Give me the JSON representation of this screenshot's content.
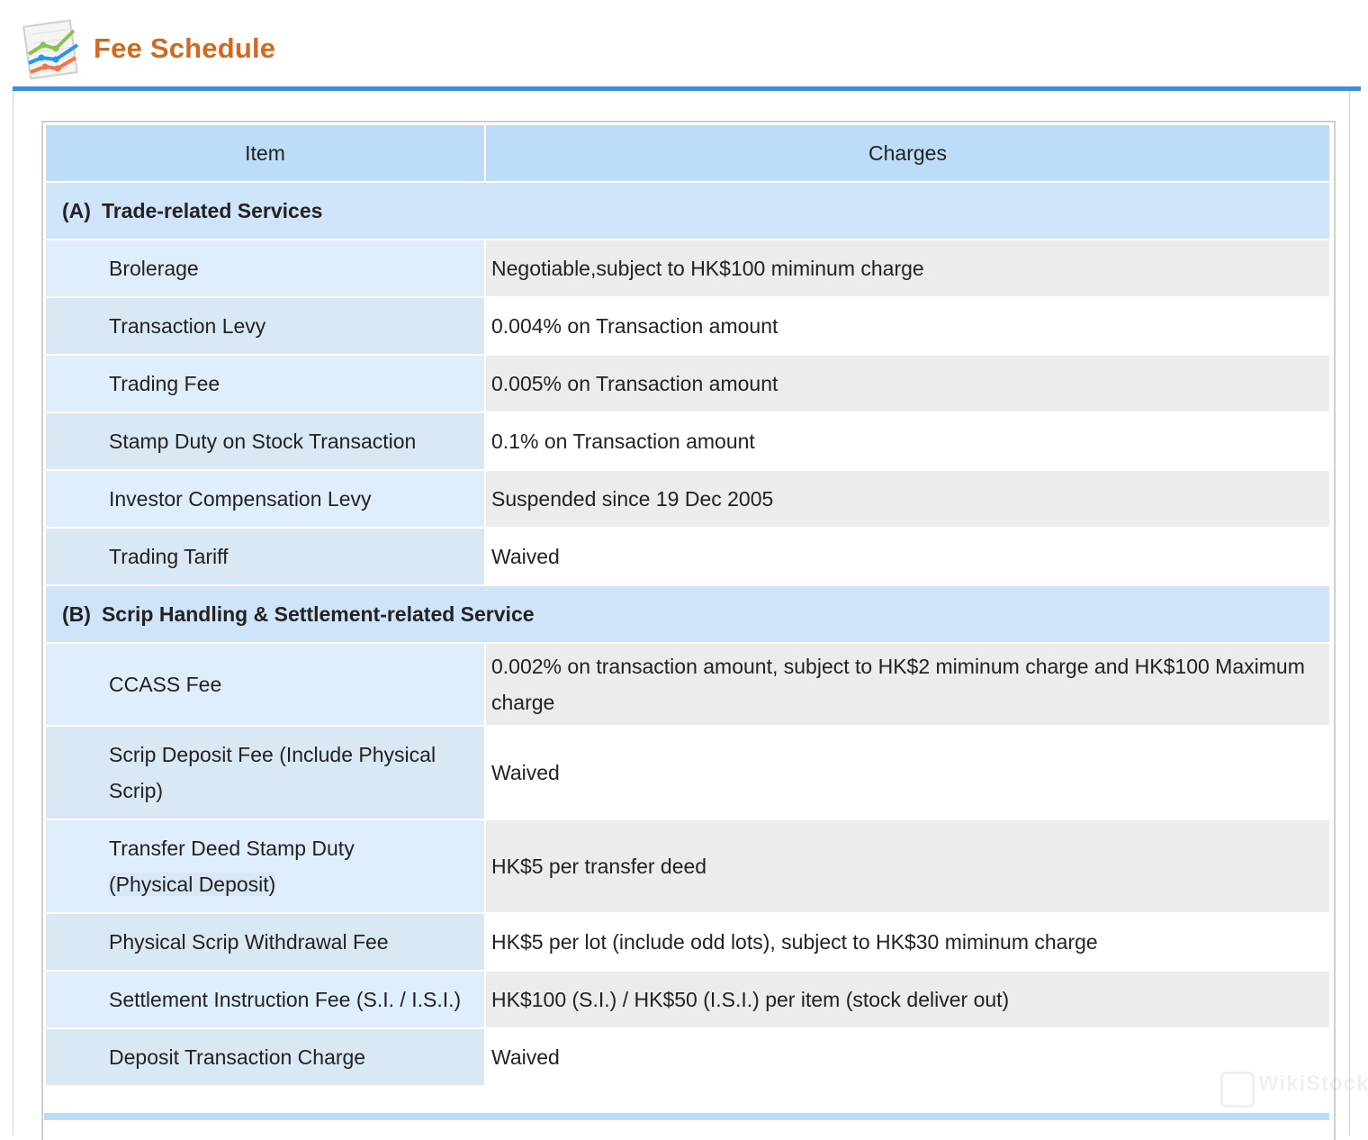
{
  "header": {
    "title": "Fee Schedule",
    "icon": "chart-icon"
  },
  "table": {
    "col_item": "Item",
    "col_charges": "Charges",
    "section_a": {
      "mark": "(A)",
      "title": "Trade-related Services"
    },
    "section_a_rows": [
      {
        "item": "Brolerage",
        "charge": "Negotiable,subject to HK$100 miminum charge"
      },
      {
        "item": "Transaction Levy",
        "charge": "0.004% on Transaction amount"
      },
      {
        "item": "Trading Fee",
        "charge": "0.005% on Transaction amount"
      },
      {
        "item": "Stamp Duty on Stock Transaction",
        "charge": "0.1% on Transaction amount"
      },
      {
        "item": "Investor Compensation Levy",
        "charge": "Suspended since 19 Dec 2005"
      },
      {
        "item": "Trading Tariff",
        "charge": "Waived"
      }
    ],
    "section_b": {
      "mark": "(B)",
      "title": "Scrip Handling & Settlement-related Service"
    },
    "section_b_rows": [
      {
        "item": "CCASS Fee",
        "charge": "0.002% on transaction amount, subject to HK$2 miminum charge and HK$100 Maximum charge"
      },
      {
        "item": "Scrip Deposit Fee (Include Physical Scrip)",
        "charge": "Waived"
      },
      {
        "item_line1": "Transfer Deed Stamp Duty",
        "item_line2": "(Physical Deposit)",
        "charge": "HK$5 per transfer deed"
      },
      {
        "item": "Physical Scrip Withdrawal Fee",
        "charge": "HK$5 per lot (include odd lots), subject to HK$30 miminum charge"
      },
      {
        "item": "Settlement Instruction Fee (S.I. / I.S.I.)",
        "charge": "HK$100 (S.I.) / HK$50 (I.S.I.) per item (stock deliver out)"
      },
      {
        "item": "Deposit Transaction Charge",
        "charge": "Waived"
      }
    ]
  },
  "watermark": "WikiStock",
  "colors": {
    "title": "#d2691e",
    "rule": "#3b8fd6",
    "header_bg": "#bcdcf8",
    "section_bg": "#cfe4f8"
  }
}
